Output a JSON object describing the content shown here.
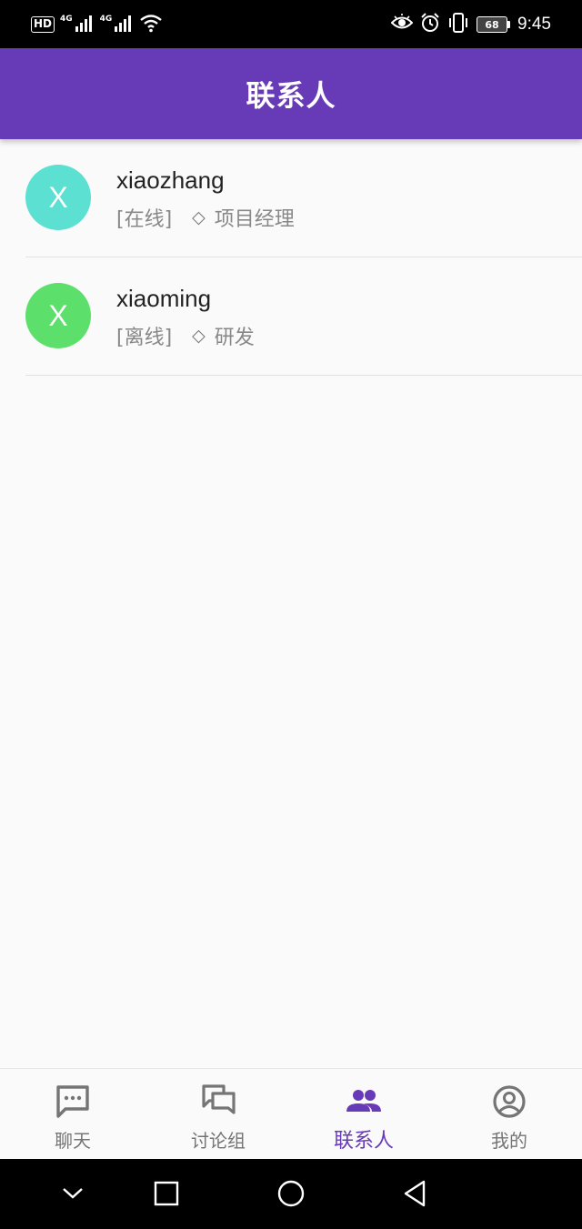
{
  "status_bar": {
    "left": {
      "hd_badge": "HD",
      "net1_label": "4G",
      "net2_label": "4G",
      "icons": [
        "hd-icon",
        "signal-icon",
        "signal-icon",
        "wifi-icon"
      ]
    },
    "right": {
      "icons": [
        "eye-icon",
        "alarm-icon",
        "vibrate-icon",
        "battery-icon"
      ],
      "battery_level": "68",
      "time": "9:45"
    }
  },
  "app_bar": {
    "title": "联系人",
    "color": "#673ab7"
  },
  "contacts": [
    {
      "avatar_letter": "X",
      "avatar_color": "#5ce0d2",
      "name": "xiaozhang",
      "status": "[在线]",
      "separator": "◇",
      "role": "项目经理"
    },
    {
      "avatar_letter": "X",
      "avatar_color": "#5ddf6c",
      "name": "xiaoming",
      "status": "[离线]",
      "separator": "◇",
      "role": "研发"
    }
  ],
  "bottom_nav": {
    "active_color": "#673ab7",
    "inactive_color": "#757575",
    "items": [
      {
        "label": "聊天",
        "icon": "chat-icon",
        "active": false
      },
      {
        "label": "讨论组",
        "icon": "forum-icon",
        "active": false
      },
      {
        "label": "联系人",
        "icon": "people-icon",
        "active": true
      },
      {
        "label": "我的",
        "icon": "account-circle-icon",
        "active": false
      }
    ]
  },
  "system_nav": {
    "icons": [
      "chevron-down-icon",
      "square-icon",
      "circle-icon",
      "back-triangle-icon"
    ]
  }
}
